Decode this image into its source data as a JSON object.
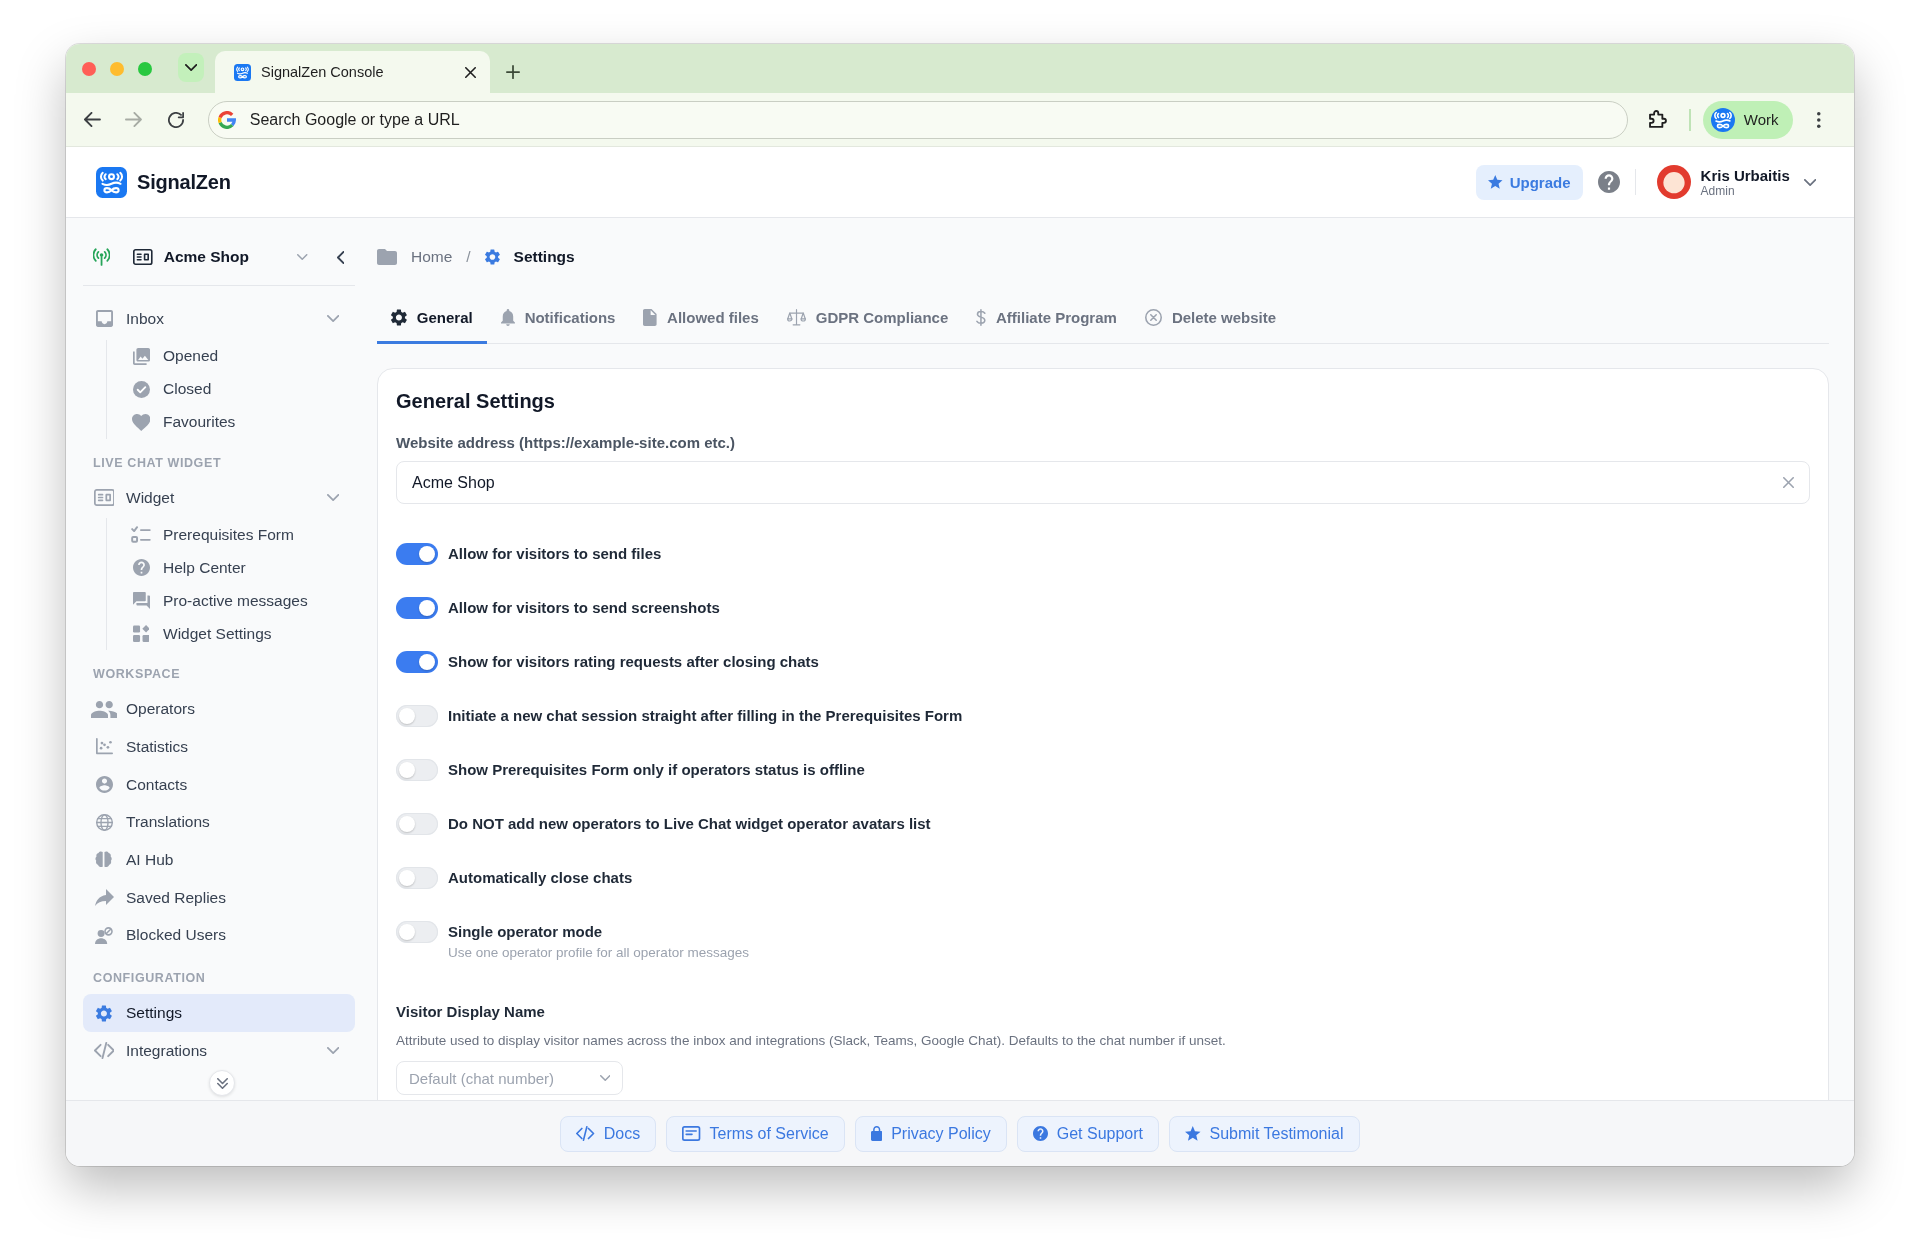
{
  "browser": {
    "tabs": [
      {
        "title": "SignalZen Console",
        "selected": true
      }
    ],
    "address_bar": {
      "placeholder": "Search Google or type a URL"
    },
    "profile": {
      "label": "Work"
    }
  },
  "header": {
    "brand": "SignalZen",
    "upgrade": "Upgrade",
    "user": {
      "name": "Kris Urbaitis",
      "role": "Admin"
    }
  },
  "sidebar": {
    "website": "Acme Shop",
    "sections": [
      {
        "items": [
          {
            "label": "Inbox",
            "selected": false,
            "expanded": true,
            "children": [
              {
                "label": "Opened",
                "selected": false
              },
              {
                "label": "Closed",
                "selected": false
              },
              {
                "label": "Favourites",
                "selected": false
              }
            ]
          }
        ]
      },
      {
        "heading": "LIVE CHAT WIDGET",
        "items": [
          {
            "label": "Widget",
            "selected": false,
            "expanded": true,
            "children": [
              {
                "label": "Prerequisites Form",
                "selected": false
              },
              {
                "label": "Help Center",
                "selected": false
              },
              {
                "label": "Pro-active messages",
                "selected": false
              },
              {
                "label": "Widget Settings",
                "selected": false
              }
            ]
          }
        ]
      },
      {
        "heading": "WORKSPACE",
        "items": [
          {
            "label": "Operators",
            "selected": false
          },
          {
            "label": "Statistics",
            "selected": false
          },
          {
            "label": "Contacts",
            "selected": false
          },
          {
            "label": "Translations",
            "selected": false
          },
          {
            "label": "AI Hub",
            "selected": false
          },
          {
            "label": "Saved Replies",
            "selected": false
          },
          {
            "label": "Blocked Users",
            "selected": false
          }
        ]
      },
      {
        "heading": "CONFIGURATION",
        "items": [
          {
            "label": "Settings",
            "selected": true
          },
          {
            "label": "Integrations",
            "selected": false,
            "expanded": true
          }
        ]
      }
    ]
  },
  "breadcrumb": {
    "separator": "/",
    "items": [
      {
        "label": "Home",
        "current": false
      },
      {
        "label": "Settings",
        "current": true
      }
    ]
  },
  "tabs": [
    {
      "label": "General",
      "selected": true
    },
    {
      "label": "Notifications",
      "selected": false
    },
    {
      "label": "Allowed files",
      "selected": false
    },
    {
      "label": "GDPR Compliance",
      "selected": false
    },
    {
      "label": "Affiliate Program",
      "selected": false
    },
    {
      "label": "Delete website",
      "selected": false
    }
  ],
  "general_settings": {
    "title": "General Settings",
    "website_field": {
      "label": "Website address (https://example-site.com etc.)",
      "value": "Acme Shop"
    },
    "toggles": [
      {
        "label": "Allow for visitors to send files",
        "on": true
      },
      {
        "label": "Allow for visitors to send screenshots",
        "on": true
      },
      {
        "label": "Show for visitors rating requests after closing chats",
        "on": true
      },
      {
        "label": "Initiate a new chat session straight after filling in the Prerequisites Form",
        "on": false
      },
      {
        "label": "Show Prerequisites Form only if operators status is offline",
        "on": false
      },
      {
        "label": "Do NOT add new operators to Live Chat widget operator avatars list",
        "on": false
      },
      {
        "label": "Automatically close chats",
        "on": false
      },
      {
        "label": "Single operator mode",
        "on": false,
        "hint": "Use one operator profile for all operator messages"
      }
    ],
    "visitor_display_name": {
      "title": "Visitor Display Name",
      "description": "Attribute used to display visitor names across the inbox and integrations (Slack, Teams, Google Chat). Defaults to the chat number if unset.",
      "select": {
        "placeholder": "Default (chat number)"
      }
    }
  },
  "footer_links": [
    "Docs",
    "Terms of Service",
    "Privacy Policy",
    "Get Support",
    "Submit Testimonial"
  ]
}
